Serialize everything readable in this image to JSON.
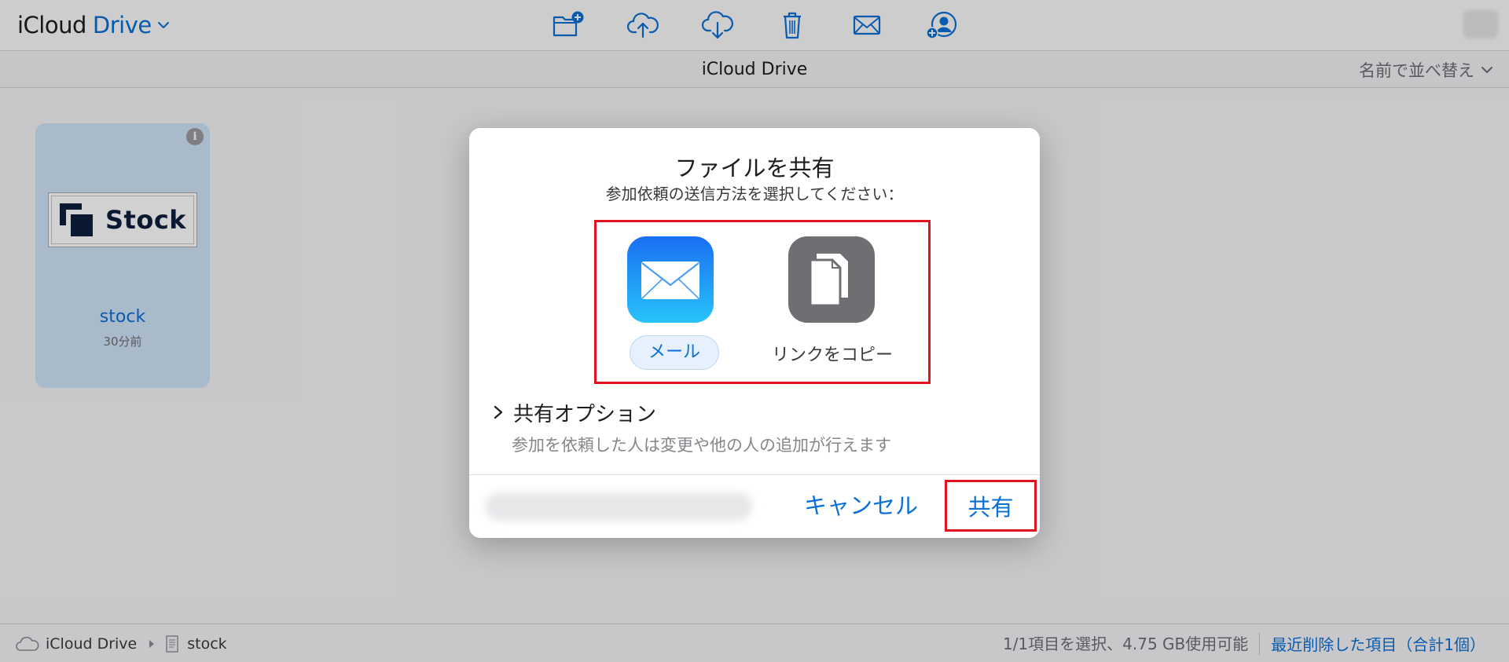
{
  "app": {
    "title_prefix": "iCloud",
    "title_accent": "Drive"
  },
  "toolbar": {
    "icons": [
      "new-folder-icon",
      "upload-icon",
      "download-icon",
      "trash-icon",
      "mail-icon",
      "add-person-icon"
    ]
  },
  "subheader": {
    "title": "iCloud Drive",
    "sort_label": "名前で並べ替え"
  },
  "file": {
    "logo_text": "Stock",
    "name": "stock",
    "modified": "30分前"
  },
  "status": {
    "breadcrumb": [
      "iCloud Drive",
      "stock"
    ],
    "quota": "1/1項目を選択、4.75 GB使用可能",
    "deleted_link": "最近削除した項目（合計1個）"
  },
  "dialog": {
    "title": "ファイルを共有",
    "subtitle": "参加依頼の送信方法を選択してください：",
    "methods": [
      {
        "label": "メール",
        "icon": "mail-app-icon",
        "selected": true
      },
      {
        "label": "リンクをコピー",
        "icon": "copy-link-icon",
        "selected": false
      }
    ],
    "options_label": "共有オプション",
    "options_desc": "参加を依頼した人は変更や他の人の追加が行えます",
    "cancel_label": "キャンセル",
    "share_label": "共有"
  },
  "colors": {
    "accent": "#0a6fd6",
    "highlight": "#e0141e",
    "file_card": "#cfe3f8"
  }
}
